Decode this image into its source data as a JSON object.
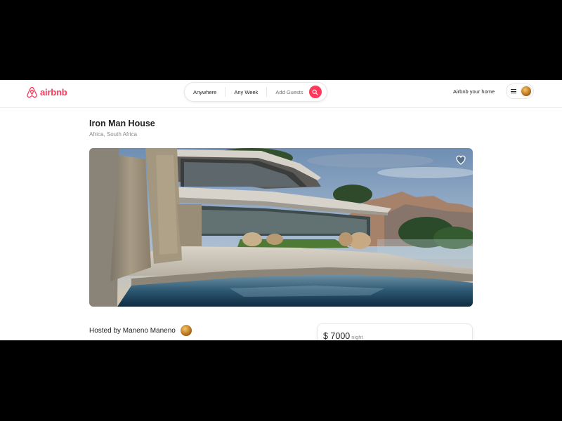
{
  "brand": {
    "name": "airbnb",
    "color": "#ff385c"
  },
  "search": {
    "where": "Anywhere",
    "when": "Any Week",
    "who": "Add Guests",
    "button_icon": "search-icon"
  },
  "header": {
    "host_link": "Airbnb your home",
    "menu_icon": "menu-icon"
  },
  "listing": {
    "title": "Iron Man House",
    "location": "Africa, South Africa",
    "hosted_by": "Hosted by Maneno Maneno",
    "price": "$ 7000",
    "price_unit": "night",
    "favorite_icon": "heart-icon"
  }
}
